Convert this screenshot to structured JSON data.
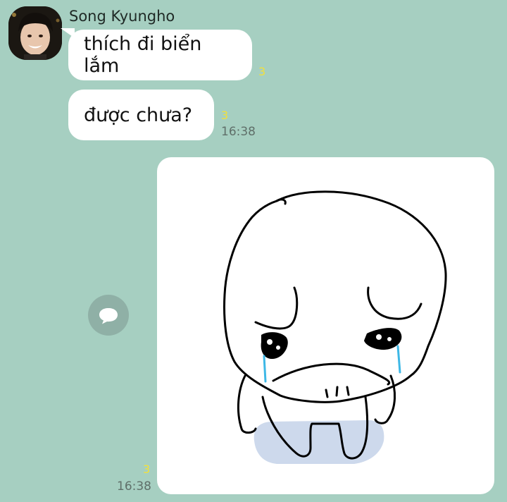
{
  "sender": {
    "name": "Song Kyungho"
  },
  "messages": [
    {
      "text": "thích đi biển lắm",
      "unread": "3"
    },
    {
      "text": "được chưa?",
      "unread": "3",
      "time": "16:38"
    }
  ],
  "sticker_message": {
    "unread": "3",
    "time": "16:38"
  },
  "icons": {
    "avatar": "profile-photo",
    "share": "speech-bubble-icon"
  },
  "colors": {
    "background": "#a6cfc1",
    "bubble": "#ffffff",
    "unread": "#f2e03c",
    "time": "#5f6f69",
    "share_button": "#8fb0a6"
  }
}
